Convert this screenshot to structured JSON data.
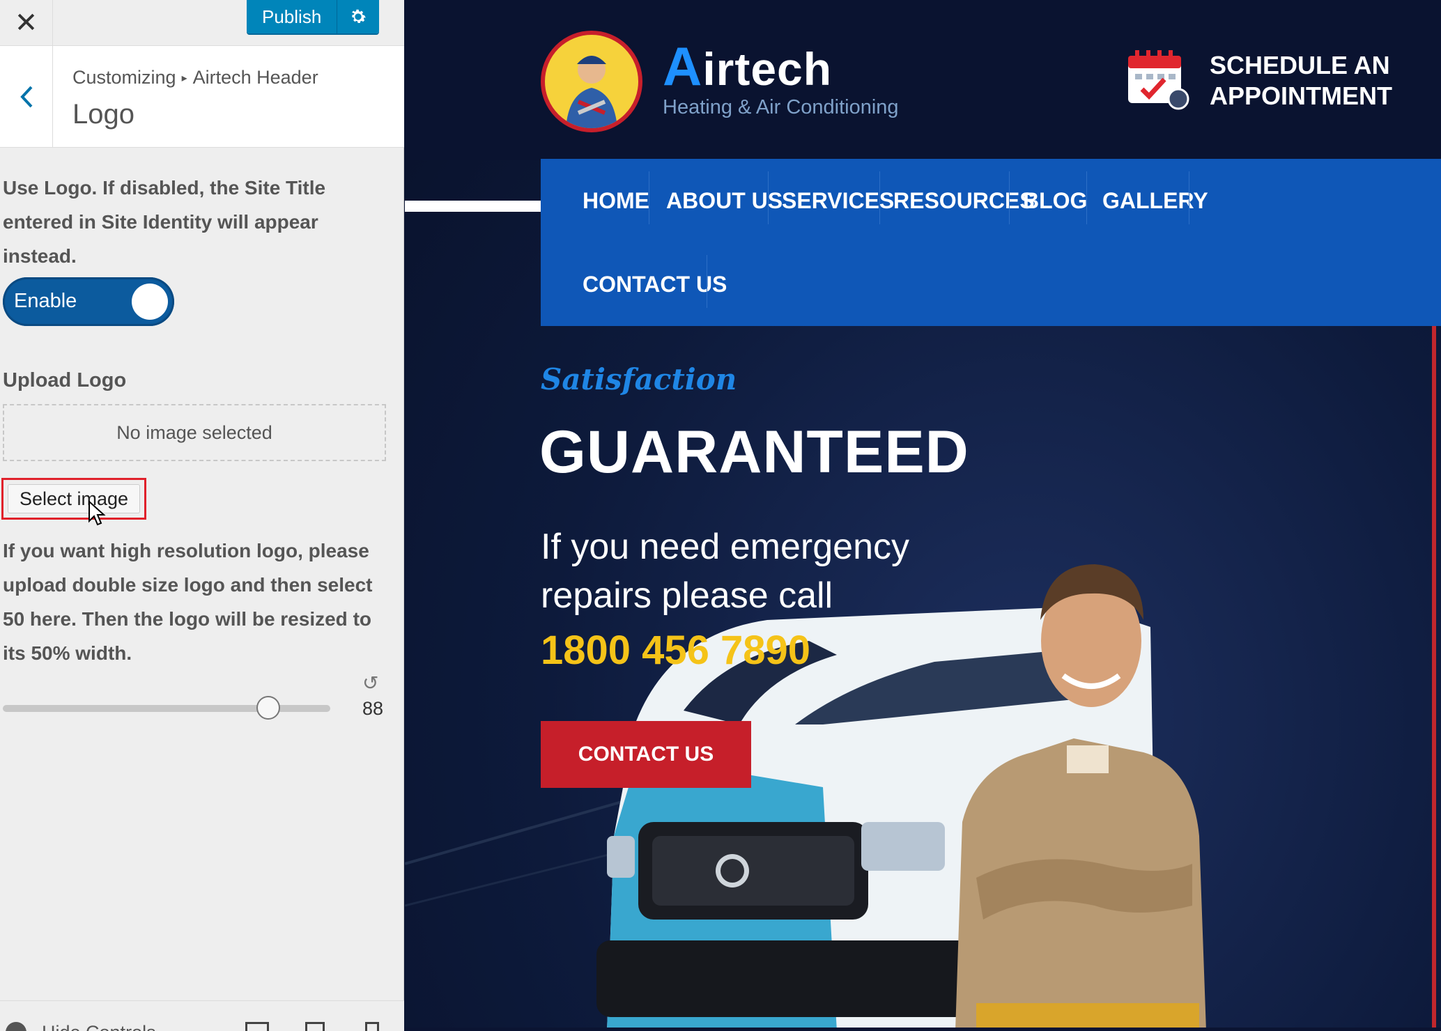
{
  "sidebar": {
    "close_glyph": "✕",
    "publish_label": "Publish",
    "breadcrumb": {
      "root": "Customizing",
      "separator": "▸",
      "parent": "Airtech Header"
    },
    "section_title": "Logo",
    "use_logo_description": "Use Logo. If disabled, the Site Title entered in Site Identity will appear instead.",
    "toggle": {
      "label": "Enable",
      "state": "on"
    },
    "upload_title": "Upload Logo",
    "no_image_text": "No image selected",
    "select_image_label": "Select image",
    "hires_description": "If you want high resolution logo, please upload double size logo and then select 50 here. Then the logo will be resized to its 50% width.",
    "slider": {
      "value": "88",
      "fraction": 0.81
    },
    "footer": {
      "hide_controls_label": "Hide Controls"
    }
  },
  "preview": {
    "brand": {
      "first_letter": "A",
      "rest": "irtech",
      "tagline": "Heating & Air Conditioning"
    },
    "appointment": {
      "line1": "SCHEDULE AN",
      "line2": "APPOINTMENT"
    },
    "nav": [
      "HOME",
      "ABOUT US",
      "SERVICES",
      "RESOURCES",
      "BLOG",
      "GALLERY",
      "CONTACT US"
    ],
    "hero": {
      "script": "Satisfaction",
      "title": "GUARANTEED",
      "text": "If you need emergency repairs please call",
      "phone": "1800 456 7890",
      "button": "CONTACT US"
    }
  },
  "colors": {
    "wp_blue": "#0085ba",
    "header_navy": "#0a1330",
    "nav_blue": "#0f57b7",
    "accent_red": "#c61f2a",
    "phone_yellow": "#f5c318",
    "script_blue": "#1f86e5",
    "highlight_red": "#e0212b"
  },
  "icons": [
    "close-icon",
    "gear-icon",
    "chevron-left-icon",
    "reset-icon",
    "cursor-icon",
    "calendar-icon",
    "desktop-icon",
    "tablet-icon",
    "mobile-icon"
  ]
}
